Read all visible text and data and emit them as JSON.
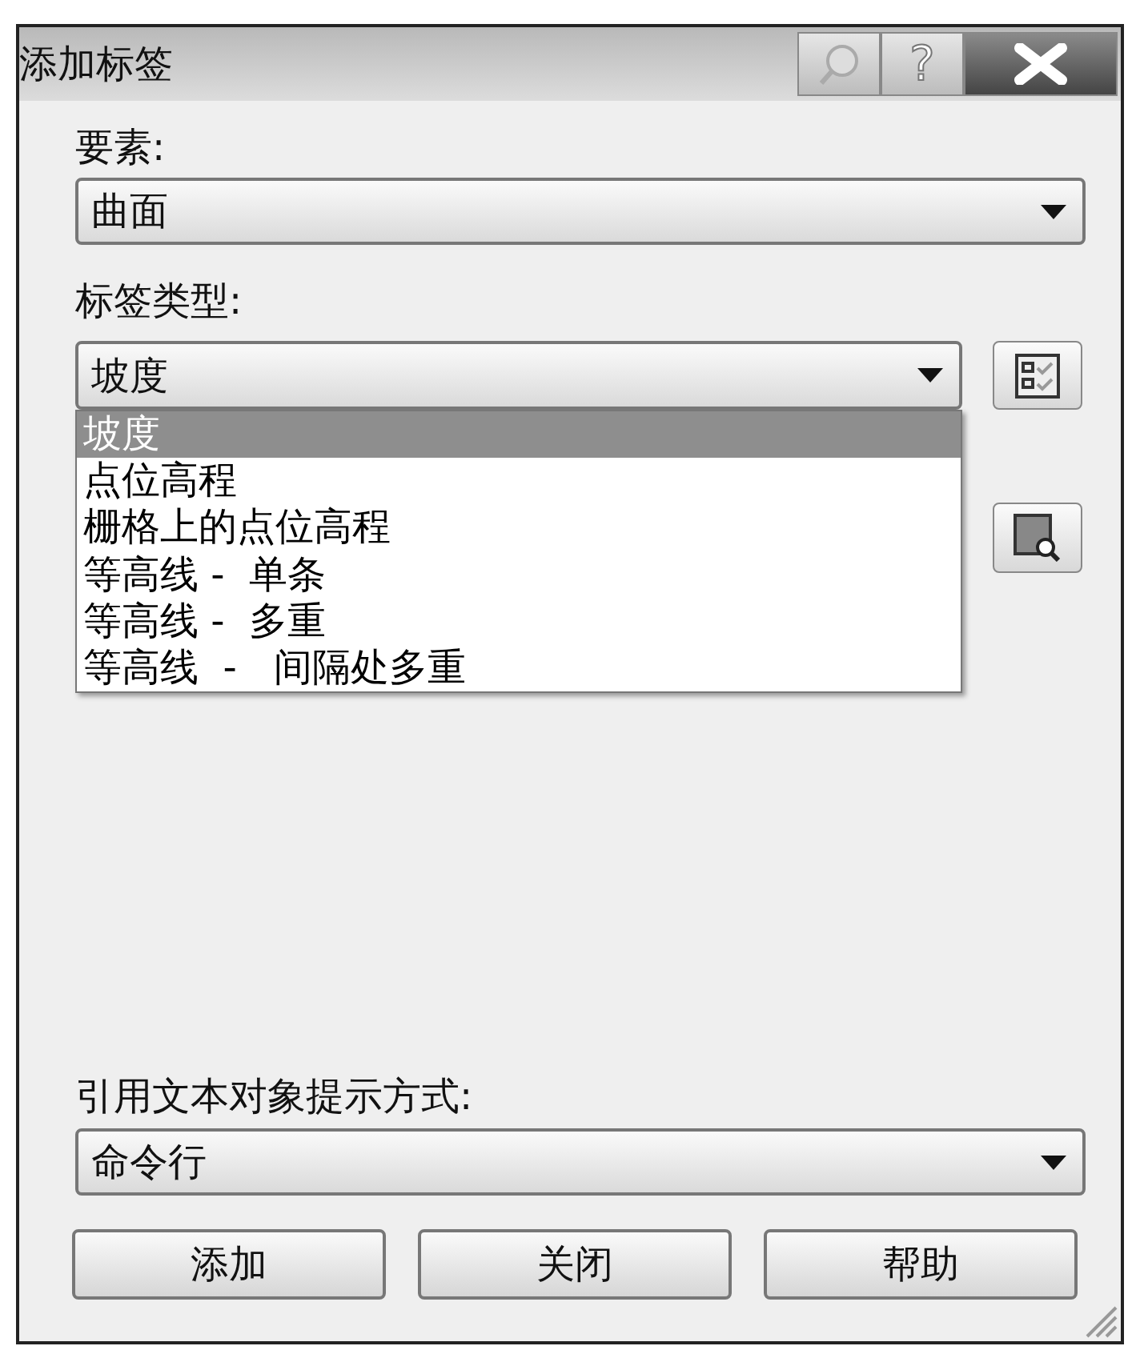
{
  "window": {
    "title": "添加标签",
    "help_button": "?"
  },
  "element": {
    "label": "要素:",
    "value": "曲面"
  },
  "label_type": {
    "label": "标签类型:",
    "value": "坡度",
    "expanded": true,
    "options": [
      {
        "label": "坡度",
        "selected": true
      },
      {
        "label": "点位高程",
        "selected": false
      },
      {
        "label": "栅格上的点位高程",
        "selected": false
      },
      {
        "label": "等高线 -  单条",
        "selected": false
      },
      {
        "label": "等高线 -  多重",
        "selected": false
      },
      {
        "label": "等高线  -   间隔处多重",
        "selected": false
      }
    ]
  },
  "prompt": {
    "label": "引用文本对象提示方式:",
    "value": "命令行"
  },
  "buttons": [
    "添加",
    "关闭",
    "帮助"
  ]
}
